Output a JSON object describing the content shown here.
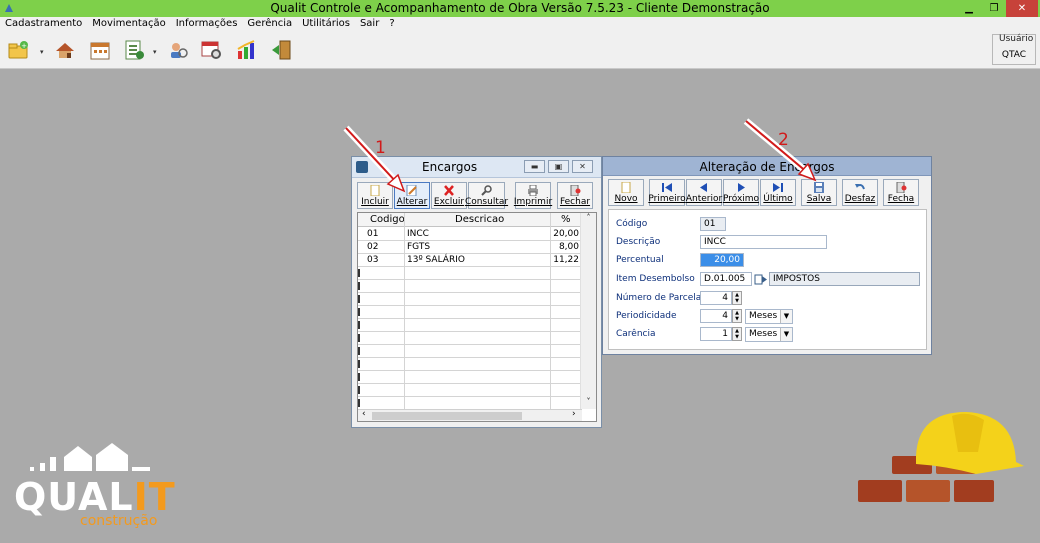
{
  "window": {
    "title": "Qualit Controle e Acompanhamento de Obra Versão 7.5.23 - Cliente Demonstração",
    "min_glyph": "▁",
    "max_glyph": "❐",
    "close_glyph": "✕"
  },
  "menu": {
    "items": [
      "Cadastramento",
      "Movimentação",
      "Informações",
      "Gerência",
      "Utilitários",
      "Sair",
      "?"
    ]
  },
  "toolbar": {
    "user_label": "Usuário",
    "user_value": "QTAC"
  },
  "encargos": {
    "title": "Encargos",
    "buttons": {
      "incluir": "Incluir",
      "alterar": "Alterar",
      "excluir": "Excluir",
      "consultar": "Consultar",
      "imprimir": "Imprimir",
      "fechar": "Fechar"
    },
    "columns": {
      "codigo": "Codigo",
      "descricao": "Descricao",
      "percent": "%"
    },
    "rows": [
      {
        "codigo": "01",
        "descricao": "INCC",
        "percent": "20,00"
      },
      {
        "codigo": "02",
        "descricao": "FGTS",
        "percent": "8,00"
      },
      {
        "codigo": "03",
        "descricao": "13º SALÁRIO",
        "percent": "11,22"
      }
    ]
  },
  "alteracao": {
    "title": "Alteração de Encargos",
    "buttons": {
      "novo": "Novo",
      "primeiro": "Primeiro",
      "anterior": "Anterior",
      "proximo": "Próximo",
      "ultimo": "Último",
      "salva": "Salva",
      "desfaz": "Desfaz",
      "fecha": "Fecha"
    },
    "fields": {
      "codigo_label": "Código",
      "codigo_value": "01",
      "descricao_label": "Descrição",
      "descricao_value": "INCC",
      "percentual_label": "Percentual",
      "percentual_value": "20,00",
      "item_label": "Item Desembolso",
      "item_code": "D.01.005",
      "item_desc": "IMPOSTOS",
      "parcelas_label": "Número de Parcelas",
      "parcelas_value": "4",
      "periodicidade_label": "Periodicidade",
      "periodicidade_value": "4",
      "periodicidade_unit": "Meses",
      "carencia_label": "Carência",
      "carencia_value": "1",
      "carencia_unit": "Meses"
    }
  },
  "annotations": {
    "step1": "1",
    "step2": "2"
  },
  "logo": {
    "main_a": "QUAL",
    "main_b": "IT",
    "sub": "construção"
  },
  "colors": {
    "titlebar": "#7ed04a",
    "accent_orange": "#f39a1e",
    "arrow_red": "#d11a1a"
  }
}
